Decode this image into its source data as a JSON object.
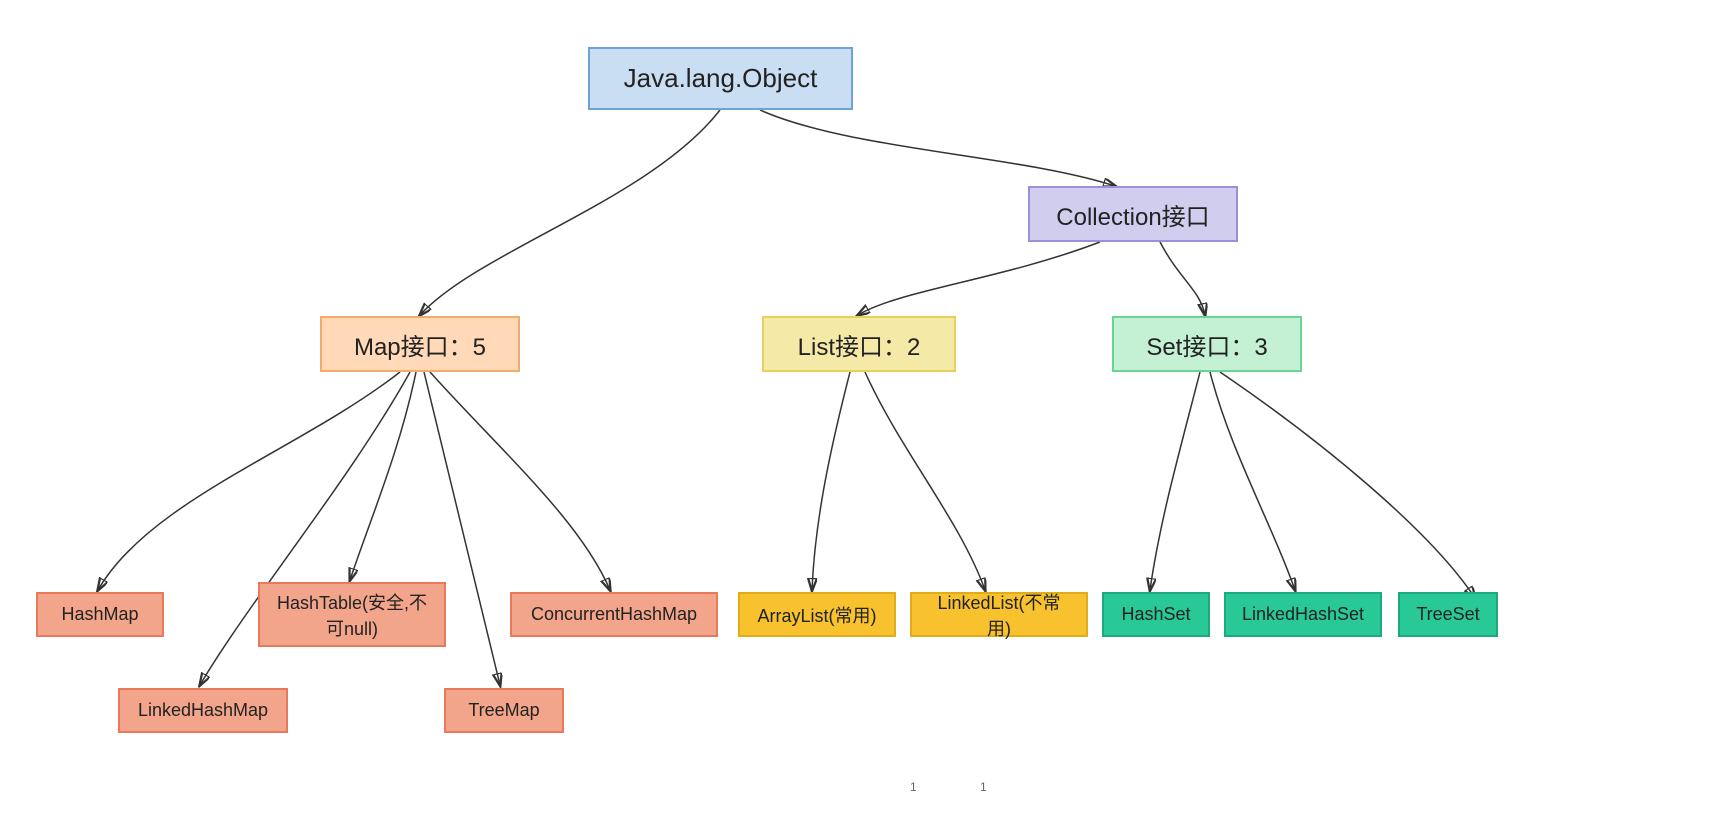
{
  "nodes": {
    "root": {
      "label": "Java.lang.Object"
    },
    "collection": {
      "label": "Collection接口"
    },
    "map": {
      "label": "Map接口：5"
    },
    "list": {
      "label": "List接口：2"
    },
    "set": {
      "label": "Set接口：3"
    },
    "hashmap": {
      "label": "HashMap"
    },
    "linkedhashmap": {
      "label": "LinkedHashMap"
    },
    "hashtable": {
      "label": "HashTable(安全,不可null)"
    },
    "treemap": {
      "label": "TreeMap"
    },
    "concurrenthashmap": {
      "label": "ConcurrentHashMap"
    },
    "arraylist": {
      "label": "ArrayList(常用)"
    },
    "linkedlist": {
      "label": "LinkedList(不常用)"
    },
    "hashset": {
      "label": "HashSet"
    },
    "linkedhashset": {
      "label": "LinkedHashSet"
    },
    "treeset": {
      "label": "TreeSet"
    }
  },
  "footer": {
    "mark1": "1",
    "mark2": "1"
  }
}
